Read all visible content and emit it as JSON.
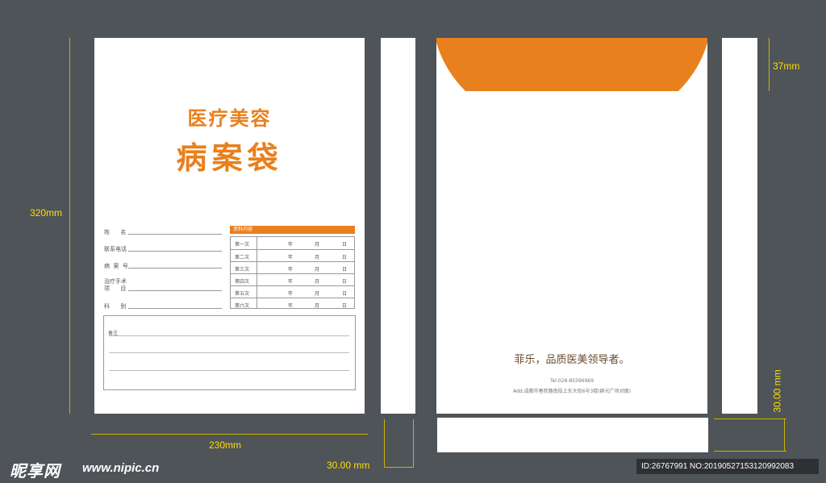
{
  "front": {
    "title_line1": "医疗美容",
    "title_line2": "病案袋",
    "fields": [
      {
        "label": "姓      名"
      },
      {
        "label": "联系电话"
      },
      {
        "label": "病  案  号"
      },
      {
        "label": "治疗手术\n项      目"
      },
      {
        "label": "科      别"
      }
    ],
    "records_header": "资料内容",
    "records": [
      {
        "label": "第一次",
        "year": "年",
        "month": "月",
        "day": "日"
      },
      {
        "label": "第二次",
        "year": "年",
        "month": "月",
        "day": "日"
      },
      {
        "label": "第三次",
        "year": "年",
        "month": "月",
        "day": "日"
      },
      {
        "label": "第四次",
        "year": "年",
        "month": "月",
        "day": "日"
      },
      {
        "label": "第五次",
        "year": "年",
        "month": "月",
        "day": "日"
      },
      {
        "label": "第六次",
        "year": "年",
        "month": "月",
        "day": "日"
      }
    ],
    "notes_label": "备注"
  },
  "back": {
    "slogan": "菲乐，品质医美领导者。",
    "tel": "Tel.028-85596969",
    "address": "Add.成都市春熙路南段上东大街6号3楼(群光广场对面)"
  },
  "dimensions": {
    "height_label": "320mm",
    "width_label": "230mm",
    "side_width_label": "30.00 mm",
    "flap_label": "37mm",
    "bottom_label": "30.00 mm"
  },
  "watermark": {
    "logo": "昵享网",
    "url": "www.nipic.cn",
    "id": "ID:26767991 NO:20190527153120992083"
  },
  "colors": {
    "accent": "#e8801e",
    "background": "#4f5459",
    "dimension": "#ffdd00"
  }
}
